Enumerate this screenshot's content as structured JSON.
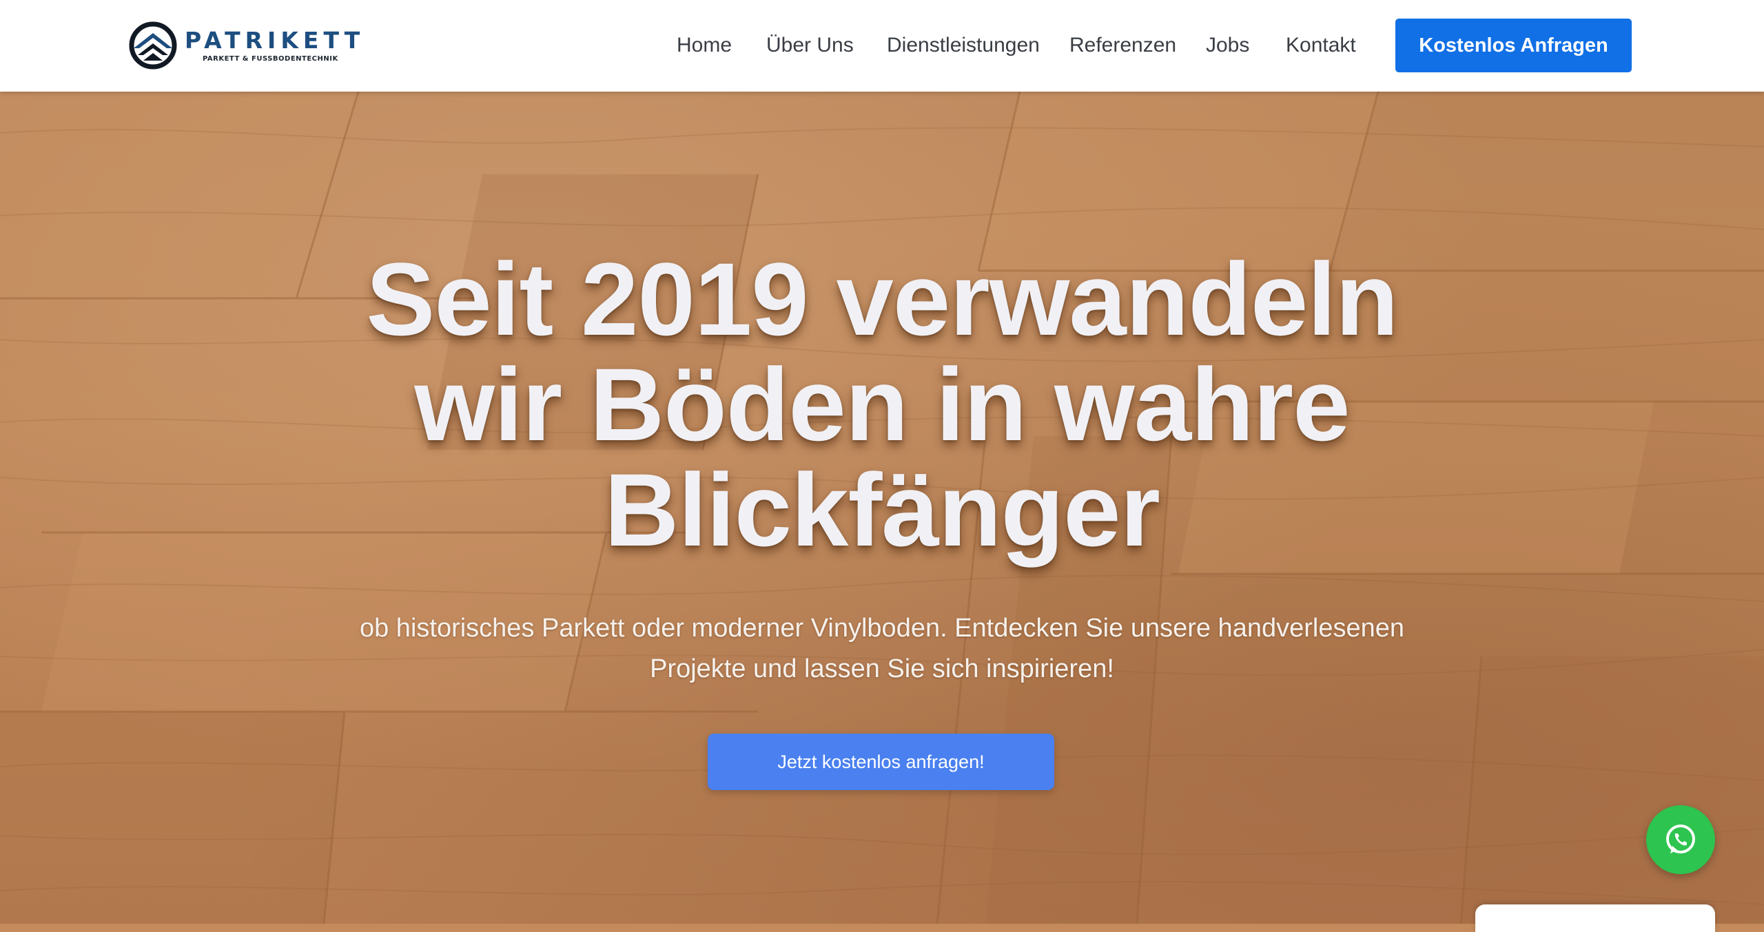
{
  "brand": {
    "name": "PATRIKETT",
    "tagline": "PARKETT & FUSSBODENTECHNIK"
  },
  "nav": {
    "items": [
      {
        "label": "Home"
      },
      {
        "label": "Über Uns"
      },
      {
        "label": "Dienstleistungen"
      },
      {
        "label": "Referenzen"
      },
      {
        "label": "Jobs"
      },
      {
        "label": "Kontakt"
      }
    ],
    "cta_label": "Kostenlos Anfragen"
  },
  "hero": {
    "title_lines": [
      "Seit 2019 verwandeln",
      "wir Böden in wahre",
      "Blickfänger"
    ],
    "subtitle_lines": [
      "ob historisches Parkett oder moderner Vinylboden. Entdecken Sie unsere handverlesenen",
      "Projekte und lassen Sie sich inspirieren!"
    ],
    "cta_label": "Jetzt kostenlos anfragen!"
  },
  "widgets": {
    "whatsapp_icon": "whatsapp-icon",
    "chat_card_icon": "chat-card"
  },
  "colors": {
    "brand_blue": "#1d4e80",
    "primary_button": "#1170e6",
    "hero_button": "#4a80f0",
    "whatsapp_green": "#2dc44f",
    "wood": "#c48a5b"
  }
}
